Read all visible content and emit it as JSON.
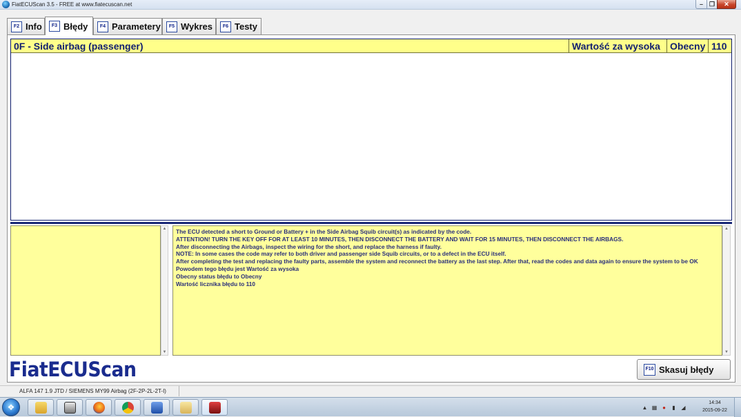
{
  "window": {
    "title": "FiatECUScan 3.5 - FREE at www.fiatecuscan.net"
  },
  "tabs": [
    {
      "key": "F2",
      "label": "Info"
    },
    {
      "key": "F3",
      "label": "Błędy"
    },
    {
      "key": "F4",
      "label": "Parametery"
    },
    {
      "key": "F5",
      "label": "Wykres"
    },
    {
      "key": "F6",
      "label": "Testy"
    }
  ],
  "active_tab": "Błędy",
  "errors": [
    {
      "name": "0F - Side airbag (passenger)",
      "description": "Wartość za wysoka",
      "status": "Obecny",
      "count": "110"
    }
  ],
  "details": {
    "lines": [
      "The ECU detected a short to Ground or Battery + in the Side Airbag Squib circuit(s) as indicated by the code.",
      "ATTENTION! TURN THE KEY OFF FOR AT LEAST 10 MINUTES, THEN DISCONNECT THE BATTERY AND WAIT FOR 15 MINUTES, THEN DISCONNECT THE AIRBAGS.",
      "After disconnecting the Airbags, inspect the wiring for the short, and replace the harness if faulty.",
      "NOTE: In some cases the code may refer to both driver and passenger side Squib circuits, or to a defect in the ECU itself.",
      "After completing the test and replacing the faulty parts, assemble the system and reconnect the battery as the last step. After that, read the codes and data again to ensure the system to be OK",
      "Powodem tego błędu jest Wartość za wysoka",
      "Obecny status błędu to Obecny",
      "Wartość licznika błędu to 110"
    ]
  },
  "logo_text": "FiatECUScan",
  "clear_button": {
    "key": "F10",
    "label": "Skasuj błędy"
  },
  "status_bar": {
    "text": "ALFA 147 1.9 JTD / SIEMENS MY99 Airbag (2F-2P-2L-2T-I)"
  },
  "clock": {
    "time": "14:34",
    "date": "2015-09-22"
  },
  "colors": {
    "error_row": "#ffff8a",
    "detail_pane": "#ffff9c",
    "text_blue": "#13206f",
    "logo_blue": "#1a2c8e"
  }
}
